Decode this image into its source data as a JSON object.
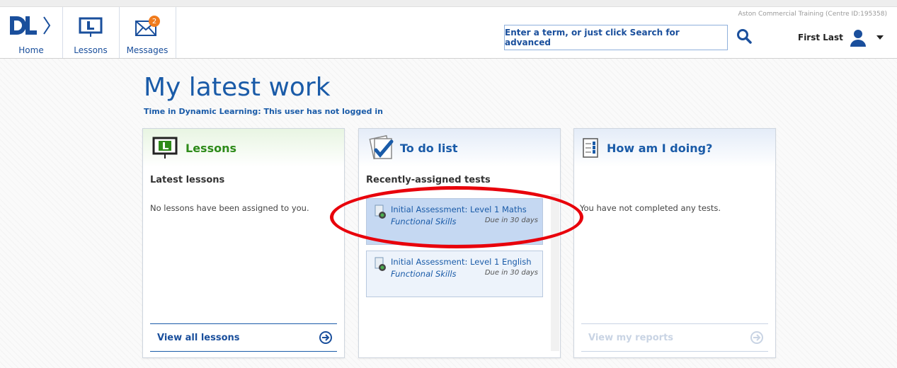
{
  "header": {
    "centre_text": "Aston Commercial Training (Centre ID:195358)",
    "nav": [
      {
        "label": "Home",
        "icon": "dl-logo-icon"
      },
      {
        "label": "Lessons",
        "icon": "lessons-icon"
      },
      {
        "label": "Messages",
        "icon": "envelope-icon",
        "badge": "2"
      }
    ],
    "search_placeholder": "Enter a term, or just click Search for advanced",
    "user_name": "First Last"
  },
  "main": {
    "title": "My latest work",
    "subtitle": "Time in Dynamic Learning: This user has not logged in"
  },
  "cards": {
    "lessons": {
      "title": "Lessons",
      "section": "Latest lessons",
      "message": "No lessons have been assigned to you.",
      "footer": "View all lessons"
    },
    "todo": {
      "title": "To do list",
      "section": "Recently-assigned tests",
      "tasks": [
        {
          "name": "Initial Assessment: Level 1 Maths",
          "subject": "Functional Skills",
          "due": "Due in 30 days",
          "highlighted": true
        },
        {
          "name": "Initial Assessment: Level 1 English",
          "subject": "Functional Skills",
          "due": "Due in 30 days",
          "highlighted": false
        }
      ]
    },
    "progress": {
      "title": "How am I doing?",
      "message": "You have not completed any tests.",
      "footer": "View my reports"
    }
  },
  "colors": {
    "brand_blue": "#1a5ba8",
    "lessons_green": "#2e8b1a",
    "highlight": "#c5d8f2",
    "annotation_red": "#e8000b"
  }
}
